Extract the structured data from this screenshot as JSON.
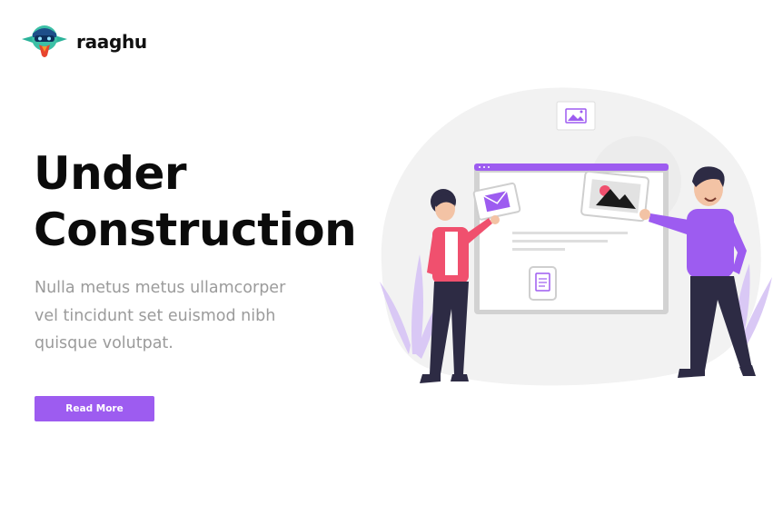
{
  "header": {
    "brand_name": "raaghu",
    "logo_icon": "parrot-mascot-icon"
  },
  "hero": {
    "title_line_1": "Under",
    "title_line_2": "Construction",
    "description_lines": [
      "Nulla metus metus ullamcorper",
      "vel tincidunt set euismod nibh",
      "quisque volutpat."
    ],
    "cta_label": "Read More"
  },
  "colors": {
    "accent": "#9d5cf0",
    "title": "#0b0b0b",
    "description": "#9b9b9b",
    "illustration_bg": "#f2f2f2"
  },
  "illustration": {
    "icons": [
      "image-icon",
      "mail-icon",
      "photo-icon",
      "document-icon"
    ]
  }
}
